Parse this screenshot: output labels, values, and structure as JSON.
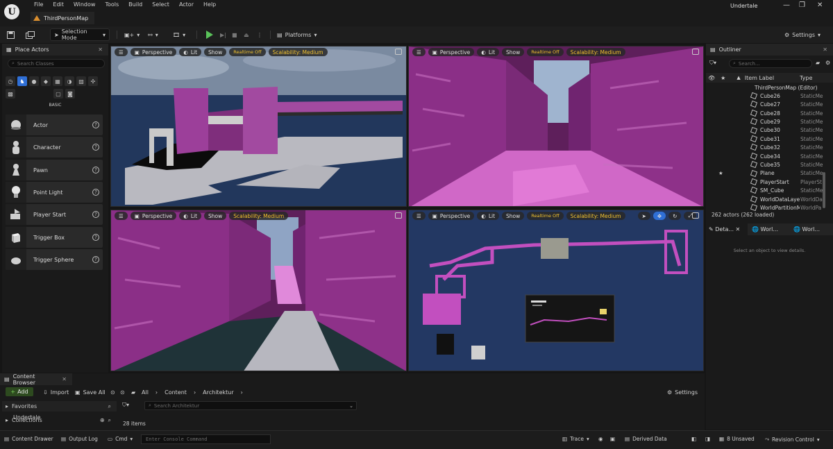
{
  "app": {
    "logo": "U",
    "menu": [
      "File",
      "Edit",
      "Window",
      "Tools",
      "Build",
      "Select",
      "Actor",
      "Help"
    ],
    "map_tab": "ThirdPersonMap",
    "project": "Undertale",
    "window_controls": [
      "—",
      "❐",
      "✕"
    ]
  },
  "toolbar": {
    "mode": "Selection Mode",
    "platforms": "Platforms",
    "settings": "Settings"
  },
  "place_actors": {
    "tab": "Place Actors",
    "search_placeholder": "Search Classes",
    "category": "BASIC",
    "items": [
      {
        "label": "Actor",
        "icon": "sphere-icon"
      },
      {
        "label": "Character",
        "icon": "character-icon"
      },
      {
        "label": "Pawn",
        "icon": "pawn-icon"
      },
      {
        "label": "Point Light",
        "icon": "light-bulb-icon"
      },
      {
        "label": "Player Start",
        "icon": "player-start-icon"
      },
      {
        "label": "Trigger Box",
        "icon": "cube-icon"
      },
      {
        "label": "Trigger Sphere",
        "icon": "trigger-sphere-icon"
      }
    ]
  },
  "viewports": [
    {
      "perspective": "Perspective",
      "lit": "Lit",
      "show": "Show",
      "realtime": "Realtime Off",
      "scalability": "Scalability: Medium"
    },
    {
      "perspective": "Perspective",
      "lit": "Lit",
      "show": "Show",
      "realtime": "Realtime Off",
      "scalability": "Scalability: Medium"
    },
    {
      "perspective": "Perspective",
      "lit": "Lit",
      "show": "Show",
      "scalability": "Scalability: Medium"
    },
    {
      "perspective": "Perspective",
      "lit": "Lit",
      "show": "Show",
      "realtime": "Realtime Off",
      "scalability": "Scalability: Medium"
    }
  ],
  "outliner": {
    "tab": "Outliner",
    "search_placeholder": "Search...",
    "col_label": "Item Label",
    "col_type": "Type",
    "root": "ThirdPersonMap (Editor)",
    "rows": [
      {
        "label": "Cube26",
        "type": "StaticMe"
      },
      {
        "label": "Cube27",
        "type": "StaticMe"
      },
      {
        "label": "Cube28",
        "type": "StaticMe"
      },
      {
        "label": "Cube29",
        "type": "StaticMe"
      },
      {
        "label": "Cube30",
        "type": "StaticMe"
      },
      {
        "label": "Cube31",
        "type": "StaticMe"
      },
      {
        "label": "Cube32",
        "type": "StaticMe"
      },
      {
        "label": "Cube34",
        "type": "StaticMe"
      },
      {
        "label": "Cube35",
        "type": "StaticMe"
      },
      {
        "label": "Plane",
        "type": "StaticMe"
      },
      {
        "label": "PlayerStart",
        "type": "PlayerSt"
      },
      {
        "label": "SM_Cube",
        "type": "StaticMe"
      },
      {
        "label": "WorldDataLaye",
        "type": "WorldDa"
      },
      {
        "label": "WorldPartitionM",
        "type": "WorldPa"
      }
    ],
    "actor_count": "262 actors (262 loaded)"
  },
  "details": {
    "tabs": [
      "Deta...",
      "Worl...",
      "Worl..."
    ],
    "empty_message": "Select an object to view details."
  },
  "content_browser": {
    "tab": "Content Browser",
    "add": "Add",
    "import": "Import",
    "save_all": "Save All",
    "breadcrumb": [
      "All",
      "Content",
      "Architektur"
    ],
    "settings": "Settings",
    "favorites": "Favorites",
    "collections": "Collections",
    "undertale": "Undertale",
    "search_placeholder": "Search Architektur",
    "item_count": "28 items"
  },
  "statusbar": {
    "content_drawer": "Content Drawer",
    "output_log": "Output Log",
    "cmd": "Cmd",
    "console_placeholder": "Enter Console Command",
    "trace": "Trace",
    "derived_data": "Derived Data",
    "unsaved": "8 Unsaved",
    "revision_control": "Revision Control"
  },
  "colors": {
    "accent_blue": "#2f6fd6",
    "play_green": "#5ac35a",
    "warning_yellow": "#f2c22e",
    "wall_purple": "#8a2f86",
    "floor_pink": "#d463c8"
  }
}
